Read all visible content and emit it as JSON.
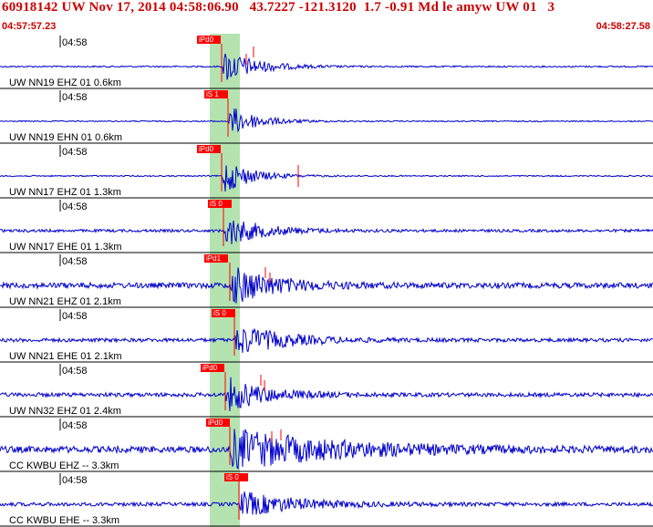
{
  "header": {
    "title": "60918142 UW Nov 17, 2014 04:58:06.90   43.7227 -121.3120  1.7 -0.91 Md le amyw UW 01   3",
    "start_time": "04:57:57.23",
    "end_time": "04:58:27.58"
  },
  "colors": {
    "trace": "#0000cc",
    "pick": "#ff0000",
    "highlight": "#b5e3b0",
    "header_text": "#cc0000"
  },
  "traces": [
    {
      "time": "04:58",
      "label": "UW NN19 EHZ 01 0.6km",
      "pick": "iPd0"
    },
    {
      "time": "04:58",
      "label": "UW NN19 EHN 01 0.6km",
      "pick": "iS 1"
    },
    {
      "time": "04:58",
      "label": "UW NN17 EHZ 01 1.3km",
      "pick": "iPd0"
    },
    {
      "time": "04:58",
      "label": "UW NN17 EHE 01 1.3km",
      "pick": "iS 0"
    },
    {
      "time": "04:58",
      "label": "UW NN21 EHZ 01 2.1km",
      "pick": "iPd1"
    },
    {
      "time": "04:58",
      "label": "UW NN21 EHE 01 2.1km",
      "pick": "iS 0"
    },
    {
      "time": "04:58",
      "label": "UW NN32 EHZ 01 2.4km",
      "pick": "iPd0"
    },
    {
      "time": "04:58",
      "label": "CC KWBU EHZ -- 3.3km",
      "pick": "iPd0"
    },
    {
      "time": "04:58",
      "label": "CC KWBU EHE -- 3.3km",
      "pick": "iS 0"
    }
  ]
}
